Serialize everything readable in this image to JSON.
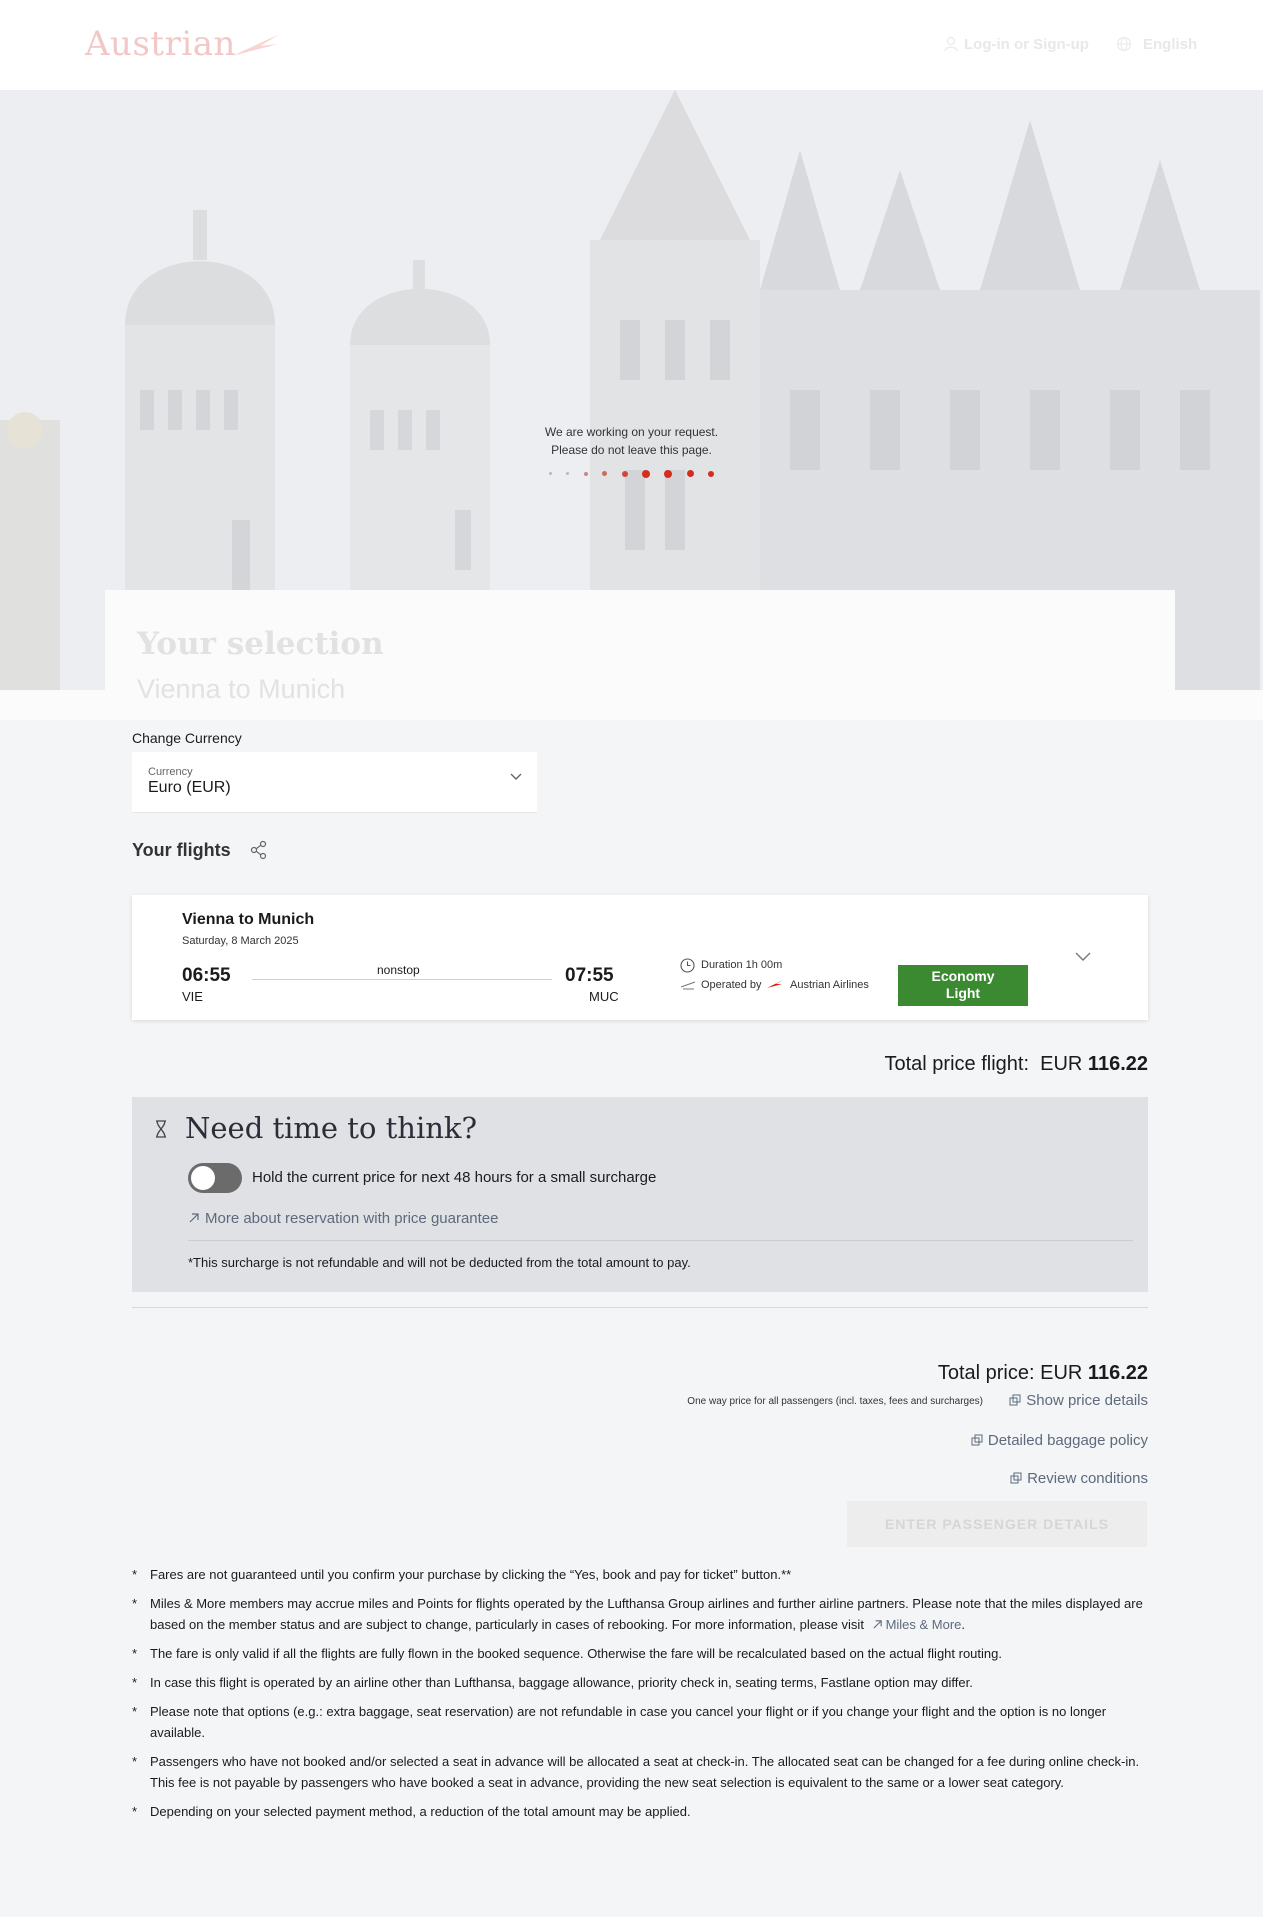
{
  "header": {
    "logo_text": "Austrian",
    "login_label": "Log-in or Sign-up",
    "language_label": "English"
  },
  "loading": {
    "line1": "We are working on your request.",
    "line2": "Please do not leave this page."
  },
  "selection": {
    "title": "Your selection",
    "subtitle": "Vienna to Munich"
  },
  "currency": {
    "section_label": "Change Currency",
    "field_label": "Currency",
    "value": "Euro (EUR)"
  },
  "flights": {
    "title": "Your flights",
    "card": {
      "route": "Vienna to Munich",
      "date": "Saturday, 8 March 2025",
      "departure_time": "06:55",
      "departure_code": "VIE",
      "stops": "nonstop",
      "arrival_time": "07:55",
      "arrival_code": "MUC",
      "duration": "Duration 1h 00m",
      "operated_by_label": "Operated by",
      "operator": "Austrian Airlines",
      "fare_line1": "Economy",
      "fare_line2": "Light"
    }
  },
  "total_flight": {
    "label": "Total price flight:",
    "currency": "EUR",
    "amount": "116.22"
  },
  "think": {
    "title": "Need time to think?",
    "toggle_label": "Hold the current price for next 48 hours for a small surcharge",
    "toggle_on": false,
    "more_link": "More about reservation with price guarantee",
    "note": "*This surcharge is not refundable and will not be deducted from the total amount to pay."
  },
  "summary": {
    "total_label": "Total price:",
    "currency": "EUR",
    "amount": "116.22",
    "one_way_note": "One way price for all passengers (incl. taxes, fees and surcharges)",
    "show_price_details": "Show price details",
    "baggage_policy": "Detailed baggage policy",
    "review_conditions": "Review conditions",
    "enter_button": "ENTER PASSENGER DETAILS"
  },
  "footnotes": {
    "f1": "Fares are not guaranteed until you confirm your purchase by clicking the “Yes, book and pay for ticket” button.**",
    "f2": "Miles & More members may accrue miles and Points for flights operated by the Lufthansa Group airlines and further airline partners. Please note that the miles displayed are based on the member status and are subject to change, particularly in cases of rebooking. For more information, please visit",
    "f2_link": "Miles & More",
    "f3": "The fare is only valid if all the flights are fully flown in the booked sequence. Otherwise the fare will be recalculated based on the actual flight routing.",
    "f4": "In case this flight is operated by an airline other than Lufthansa, baggage allowance, priority check in, seating terms, Fastlane option may differ.",
    "f5": "Please note that options (e.g.: extra baggage, seat reservation) are not refundable in case you cancel your flight or if you change your flight and the option is no longer available.",
    "f6": "Passengers who have not booked and/or selected a seat in advance will be allocated a seat at check-in. The allocated seat can be changed for a fee during online check-in. This fee is not payable by passengers who have booked a seat in advance, providing the new seat selection is equivalent to the same or a lower seat category.",
    "f7": "Depending on your selected payment method, a reduction of the total amount may be applied."
  },
  "colors": {
    "brand_red": "#d81e05",
    "fare_green": "#3b8a32",
    "link_slate": "#5d6a7c",
    "page_bg": "#f4f5f7"
  }
}
